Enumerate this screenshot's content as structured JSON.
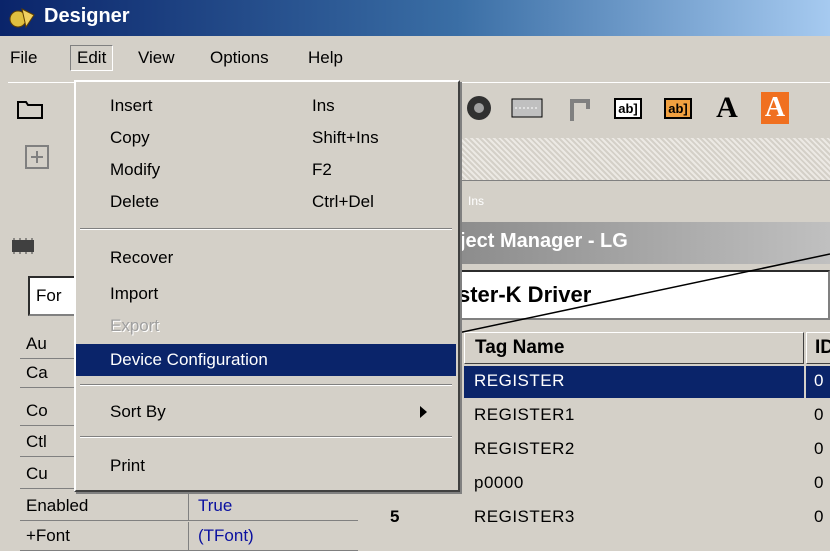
{
  "app": {
    "title": "Designer"
  },
  "menubar": [
    "File",
    "Edit",
    "View",
    "Options",
    "Help"
  ],
  "edit_menu": {
    "items": [
      {
        "label": "Insert",
        "shortcut": "Ins",
        "enabled": true
      },
      {
        "label": "Copy",
        "shortcut": "Shift+Ins",
        "enabled": true
      },
      {
        "label": "Modify",
        "shortcut": "F2",
        "enabled": true
      },
      {
        "label": "Delete",
        "shortcut": "Ctrl+Del",
        "enabled": true
      },
      {
        "label": "Recover",
        "shortcut": "",
        "enabled": true
      },
      {
        "label": "Import",
        "shortcut": "",
        "enabled": true
      },
      {
        "label": "Export",
        "shortcut": "",
        "enabled": false
      },
      {
        "label": "Device Configuration",
        "shortcut": "",
        "enabled": true,
        "highlighted": true
      },
      {
        "label": "Sort By",
        "shortcut": "",
        "enabled": true,
        "submenu": true
      },
      {
        "label": "Print",
        "shortcut": "",
        "enabled": true
      }
    ]
  },
  "toolbar": {
    "text_button_a": "A",
    "text_button_a2": "A",
    "abl_label": "ab]",
    "strip_text": "Ins"
  },
  "properties": {
    "combo_value": "For",
    "rows": [
      {
        "key": "Au",
        "value": ""
      },
      {
        "key": "Ca",
        "value": ""
      },
      {
        "key": "Co",
        "value": ""
      },
      {
        "key": "Ctl",
        "value": ""
      },
      {
        "key": "Cu",
        "value": ""
      },
      {
        "key": "Enabled",
        "value": "True"
      },
      {
        "key": "+Font",
        "value": "(TFont)"
      }
    ]
  },
  "object_manager": {
    "title": "ject Manager - LG",
    "caption": "ster-K Driver",
    "columns": [
      "Tag Name",
      "ID"
    ],
    "rows": [
      {
        "n": "",
        "tag": "REGISTER",
        "id": "0",
        "selected": true
      },
      {
        "n": "",
        "tag": "REGISTER1",
        "id": "0"
      },
      {
        "n": "",
        "tag": "REGISTER2",
        "id": "0"
      },
      {
        "n": "",
        "tag": "p0000",
        "id": "0"
      },
      {
        "n": "5",
        "tag": "REGISTER3",
        "id": "0"
      }
    ]
  }
}
